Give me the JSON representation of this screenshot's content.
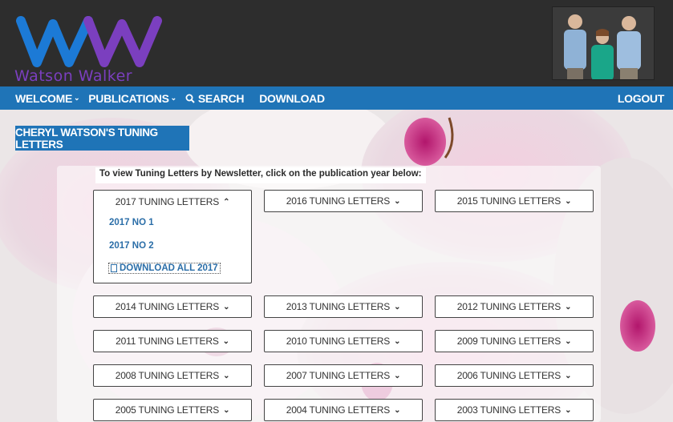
{
  "header": {
    "logo_text": "Watson Walker"
  },
  "nav": {
    "left": [
      {
        "label": "WELCOME",
        "has_dropdown": true,
        "icon": ""
      },
      {
        "label": "PUBLICATIONS",
        "has_dropdown": true,
        "icon": ""
      },
      {
        "label": "SEARCH",
        "has_dropdown": false,
        "icon": "search-icon"
      },
      {
        "label": "DOWNLOAD",
        "has_dropdown": false,
        "icon": ""
      }
    ],
    "right": {
      "label": "LOGOUT"
    }
  },
  "page": {
    "title": "CHERYL WATSON'S TUNING LETTERS",
    "instruction": "To view Tuning Letters by Newsletter, click on the publication year below:"
  },
  "years": [
    {
      "label": "2017 TUNING LETTERS",
      "expanded": true
    },
    {
      "label": "2016 TUNING LETTERS",
      "expanded": false
    },
    {
      "label": "2015 TUNING LETTERS",
      "expanded": false
    },
    {
      "label": "2014 TUNING LETTERS",
      "expanded": false
    },
    {
      "label": "2013 TUNING LETTERS",
      "expanded": false
    },
    {
      "label": "2012 TUNING LETTERS",
      "expanded": false
    },
    {
      "label": "2011 TUNING LETTERS",
      "expanded": false
    },
    {
      "label": "2010 TUNING LETTERS",
      "expanded": false
    },
    {
      "label": "2009 TUNING LETTERS",
      "expanded": false
    },
    {
      "label": "2008 TUNING LETTERS",
      "expanded": false
    },
    {
      "label": "2007 TUNING LETTERS",
      "expanded": false
    },
    {
      "label": "2006 TUNING LETTERS",
      "expanded": false
    },
    {
      "label": "2005 TUNING LETTERS",
      "expanded": false
    },
    {
      "label": "2004 TUNING LETTERS",
      "expanded": false
    },
    {
      "label": "2003 TUNING LETTERS",
      "expanded": false
    }
  ],
  "dropdown_2017": {
    "items": [
      "2017 NO 1",
      "2017 NO 2"
    ],
    "download_all": "DOWNLOAD ALL 2017"
  },
  "colors": {
    "nav_blue": "#1f74b7",
    "link_blue": "#2b6ea8",
    "logo_blue": "#1c7ad6",
    "logo_purple": "#7b3fbf"
  }
}
